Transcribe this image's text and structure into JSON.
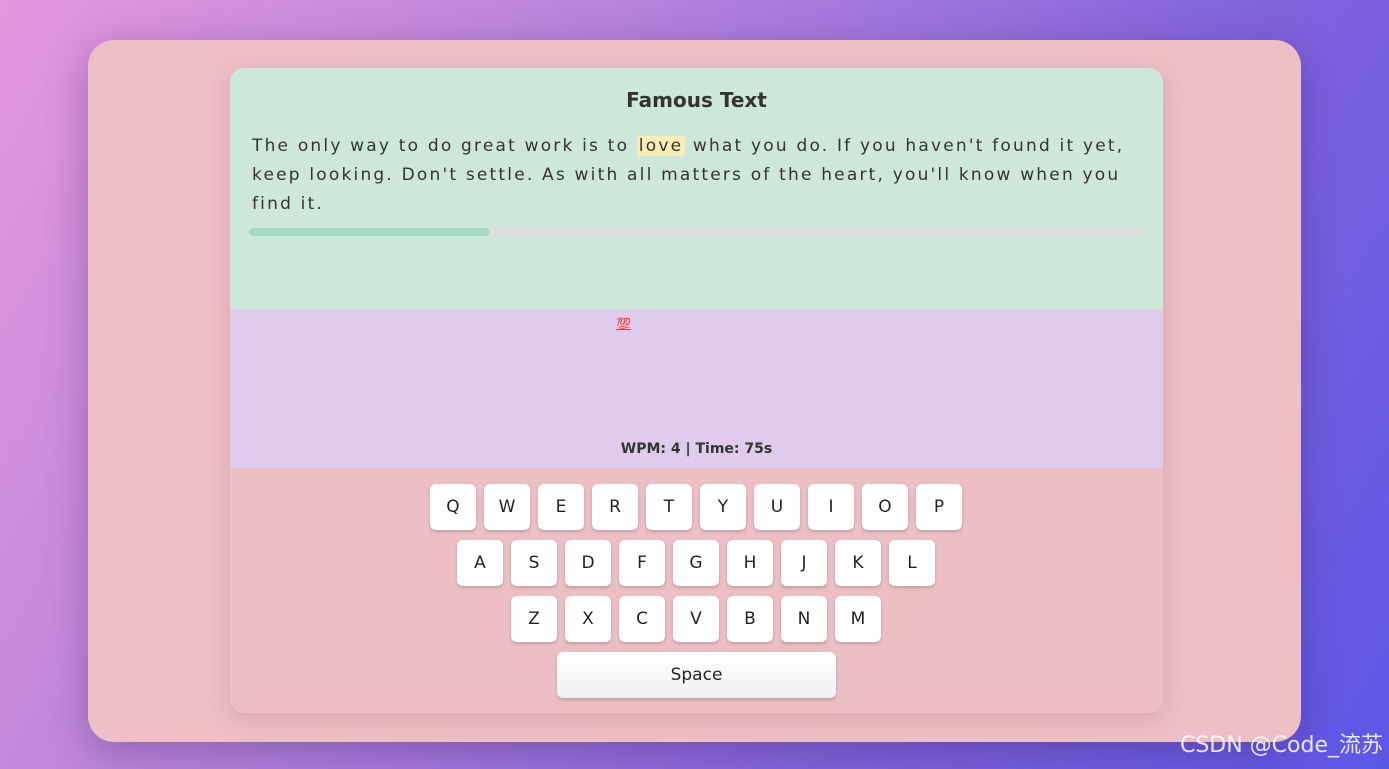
{
  "header": {
    "title": "Famous Text"
  },
  "passage": {
    "before": "The only way to do great work is to ",
    "highlight": "love",
    "after": " what you do. If you haven't found it yet, keep looking. Don't settle. As with all matters of the heart, you'll know when you find it."
  },
  "progress": {
    "fraction": 0.27,
    "color": "#a3dcc2"
  },
  "stats": {
    "emoji": "💯",
    "text": "WPM: 4 | Time: 75s"
  },
  "keyboard": {
    "rows": [
      [
        "Q",
        "W",
        "E",
        "R",
        "T",
        "Y",
        "U",
        "I",
        "O",
        "P"
      ],
      [
        "A",
        "S",
        "D",
        "F",
        "G",
        "H",
        "J",
        "K",
        "L"
      ],
      [
        "Z",
        "X",
        "C",
        "V",
        "B",
        "N",
        "M"
      ]
    ],
    "space_label": "Space"
  },
  "colors": {
    "text_panel": "#cde8db",
    "stats_panel": "#dfcbeb",
    "keyboard_panel": "#ecbfc5",
    "highlight": "#fbedb3"
  },
  "watermark": "CSDN @Code_流苏"
}
